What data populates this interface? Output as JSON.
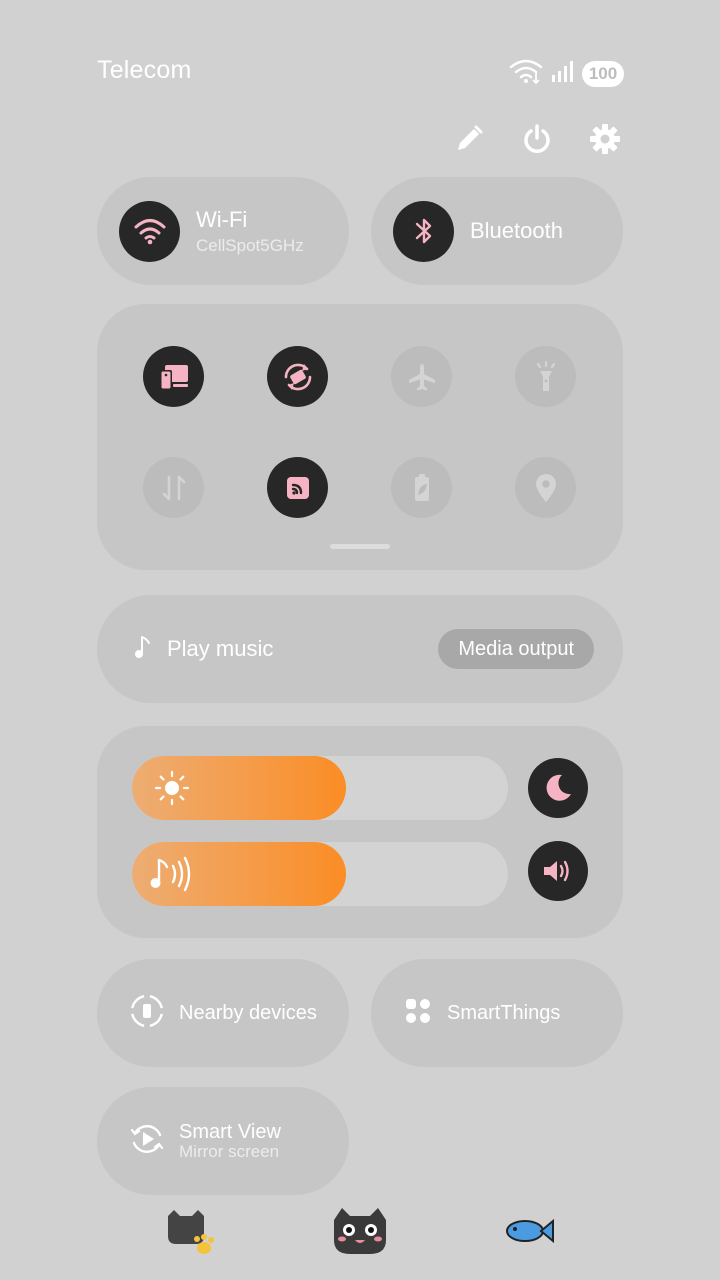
{
  "status_bar": {
    "carrier": "Telecom",
    "battery": "100",
    "icons": [
      "wifi-icon",
      "signal-icon",
      "battery-icon"
    ]
  },
  "top_actions": [
    "edit-pencil-icon",
    "power-icon",
    "settings-gear-icon"
  ],
  "tiles": {
    "wifi": {
      "title": "Wi-Fi",
      "subtitle": "CellSpot5GHz",
      "active": true
    },
    "bluetooth": {
      "title": "Bluetooth",
      "active": true
    }
  },
  "quick_grid": [
    {
      "icon": "screen-share-icon",
      "active": true
    },
    {
      "icon": "auto-rotate-icon",
      "active": true
    },
    {
      "icon": "airplane-icon",
      "active": false
    },
    {
      "icon": "flashlight-icon",
      "active": false
    },
    {
      "icon": "mobile-data-icon",
      "active": false
    },
    {
      "icon": "nfc-icon",
      "active": true
    },
    {
      "icon": "power-saving-icon",
      "active": false
    },
    {
      "icon": "location-icon",
      "active": false
    }
  ],
  "media": {
    "label": "Play music",
    "output_button": "Media output"
  },
  "sliders": {
    "brightness": {
      "level": 0.57,
      "icon": "sun-icon"
    },
    "volume": {
      "level": 0.57,
      "icon": "music-note-icon"
    },
    "night_mode_icon": "moon-icon",
    "sound_icon": "speaker-icon"
  },
  "bottom_tiles": {
    "nearby": {
      "label": "Nearby devices"
    },
    "smartthings": {
      "label": "SmartThings"
    },
    "smartview": {
      "title": "Smart View",
      "subtitle": "Mirror screen"
    }
  },
  "colors": {
    "background": "#d1d1d1",
    "panel": "#c6c6c6",
    "active_circle": "#272727",
    "accent_pink": "#f5b3c3",
    "slider_fill_start": "#edad73",
    "slider_fill_end": "#fb8d25"
  }
}
